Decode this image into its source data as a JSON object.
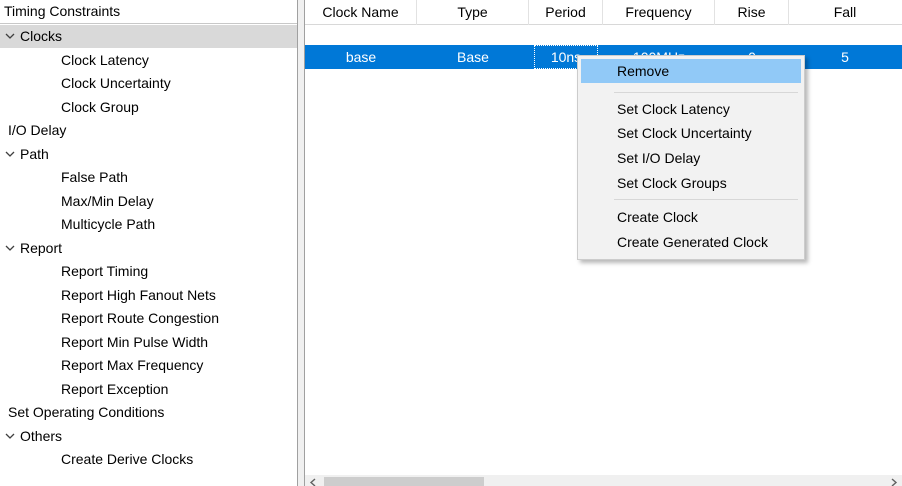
{
  "tree": {
    "header": "Timing Constraints",
    "items": [
      {
        "label": "Clocks",
        "level": 0,
        "expandable": true,
        "selected": true
      },
      {
        "label": "Clock Latency",
        "level": 1
      },
      {
        "label": "Clock Uncertainty",
        "level": 1
      },
      {
        "label": "Clock Group",
        "level": 1
      },
      {
        "label": "I/O Delay",
        "level": 0
      },
      {
        "label": "Path",
        "level": 0,
        "expandable": true
      },
      {
        "label": "False Path",
        "level": 1
      },
      {
        "label": "Max/Min Delay",
        "level": 1
      },
      {
        "label": "Multicycle Path",
        "level": 1
      },
      {
        "label": "Report",
        "level": 0,
        "expandable": true
      },
      {
        "label": "Report Timing",
        "level": 1
      },
      {
        "label": "Report High Fanout Nets",
        "level": 1
      },
      {
        "label": "Report Route Congestion",
        "level": 1
      },
      {
        "label": "Report Min Pulse Width",
        "level": 1
      },
      {
        "label": "Report Max Frequency",
        "level": 1
      },
      {
        "label": "Report Exception",
        "level": 1
      },
      {
        "label": "Set Operating Conditions",
        "level": 0
      },
      {
        "label": "Others",
        "level": 0,
        "expandable": true
      },
      {
        "label": "Create Derive Clocks",
        "level": 1
      }
    ]
  },
  "table": {
    "columns": [
      "Clock Name",
      "Type",
      "Period",
      "Frequency",
      "Rise",
      "Fall"
    ],
    "rows": [
      [
        "base",
        "Base",
        "10ns",
        "100MHz",
        "0",
        "5"
      ]
    ],
    "selected_color": "#0078d7"
  },
  "context_menu": {
    "items": [
      {
        "label": "Remove",
        "highlighted": true
      },
      {
        "separator": true
      },
      {
        "label": "Set Clock Latency"
      },
      {
        "label": "Set Clock Uncertainty"
      },
      {
        "label": "Set I/O Delay"
      },
      {
        "label": "Set Clock Groups"
      },
      {
        "separator": true
      },
      {
        "label": "Create Clock"
      },
      {
        "label": "Create Generated Clock"
      }
    ]
  },
  "scrollbar": {
    "left_arrow": "<",
    "right_arrow": ">"
  }
}
